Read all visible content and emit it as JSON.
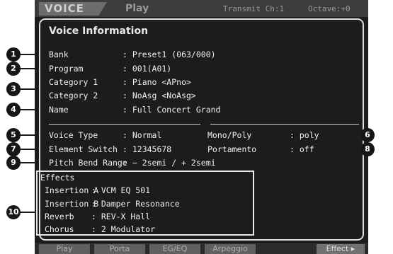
{
  "header": {
    "tab_voice": "VOICE",
    "tab_play": "Play",
    "transmit": "Transmit Ch:1",
    "octave": "Octave:+0"
  },
  "panel": {
    "title": "Voice Information",
    "bank": {
      "label": "Bank",
      "value": ": Preset1 (063/000)"
    },
    "program": {
      "label": "Program",
      "value": ": 001(A01)"
    },
    "category1": {
      "label": "Category 1",
      "value": ": Piano <APno>"
    },
    "category2": {
      "label": "Category 2",
      "value": ": NoAsg <NoAsg>"
    },
    "name": {
      "label": "Name",
      "value": ": Full Concert Grand"
    },
    "voice_type": {
      "label": "Voice Type",
      "value": ": Normal"
    },
    "mono_poly": {
      "label": "Mono/Poly",
      "value": ": poly"
    },
    "element_switch": {
      "label": "Element Switch",
      "value": ": 12345678"
    },
    "portamento": {
      "label": "Portamento",
      "value": ": off"
    },
    "pitch_bend_range": {
      "label": "Pitch Bend Range",
      "value": ": − 2semi / + 2semi"
    }
  },
  "effects": {
    "title": "Effects",
    "rows": [
      {
        "label": "Insertion A",
        "value": ": VCM EQ 501"
      },
      {
        "label": "Insertion B",
        "value": ": Damper Resonance"
      },
      {
        "label": "Reverb",
        "value": ": REV-X Hall"
      },
      {
        "label": "Chorus",
        "value": ": 2 Modulator"
      }
    ]
  },
  "bottom_tabs": [
    "Play",
    "Porta",
    "EG/EQ",
    "Arpeggio",
    "Effect"
  ],
  "callouts": [
    "1",
    "2",
    "3",
    "4",
    "5",
    "6",
    "7",
    "8",
    "9",
    "10"
  ],
  "colors": {
    "screen": "#1c1c1c",
    "text": "#f0f0f0",
    "tab": "#606060",
    "callout": "#161616"
  }
}
